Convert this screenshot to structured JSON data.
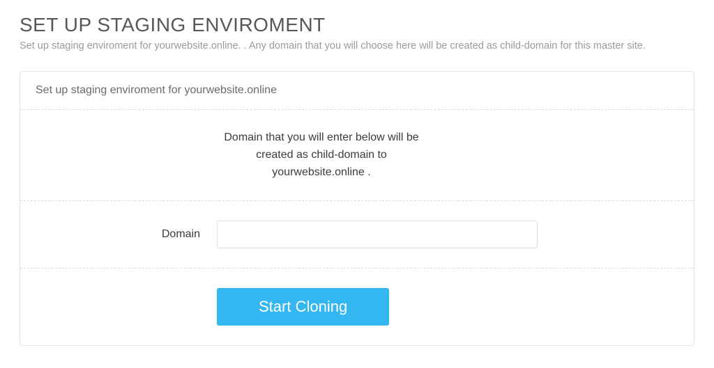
{
  "header": {
    "title": "SET UP STAGING ENVIROMENT",
    "subtitle": "Set up staging enviroment for yourwebsite.online. . Any domain that you will choose here will be created as child-domain for this master site."
  },
  "panel": {
    "heading": "Set up staging enviroment for yourwebsite.online",
    "description": "Domain that you will enter below will be created as child-domain to yourwebsite.online .",
    "form": {
      "domain_label": "Domain",
      "domain_value": ""
    },
    "actions": {
      "start_cloning_label": "Start Cloning"
    }
  },
  "colors": {
    "primary": "#34b7f1"
  }
}
